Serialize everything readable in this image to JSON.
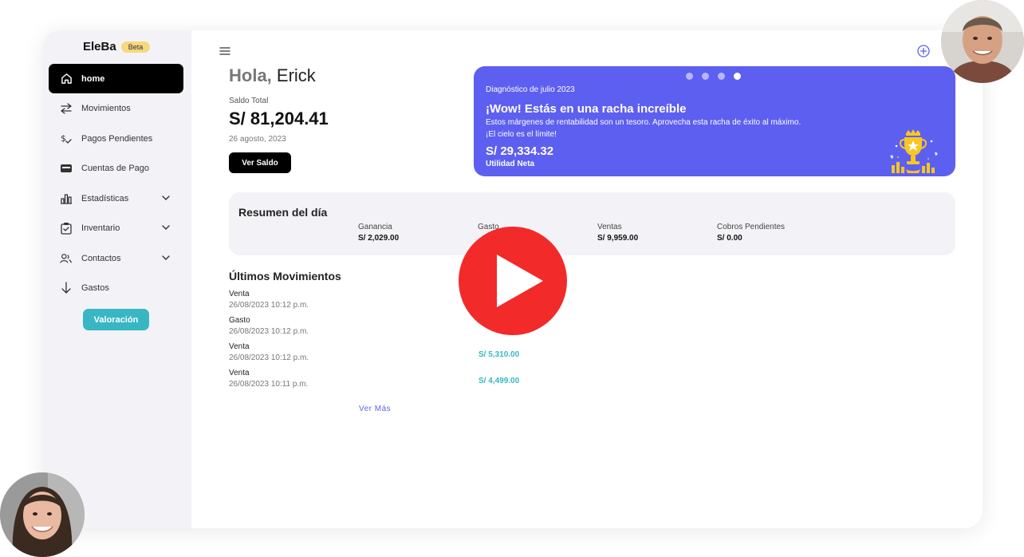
{
  "brand": {
    "name": "EleBa",
    "badge": "Beta"
  },
  "sidebar": {
    "items": [
      {
        "label": "home",
        "icon": "home-icon",
        "active": true
      },
      {
        "label": "Movimientos",
        "icon": "arrows-swap-icon"
      },
      {
        "label": "Pagos Pendientes",
        "icon": "dollar-check-icon"
      },
      {
        "label": "Cuentas de Pago",
        "icon": "wallet-icon"
      },
      {
        "label": "Estadísticas",
        "icon": "bar-chart-icon",
        "expandable": true
      },
      {
        "label": "Inventario",
        "icon": "clipboard-check-icon",
        "expandable": true
      },
      {
        "label": "Contactos",
        "icon": "users-icon",
        "expandable": true
      },
      {
        "label": "Gastos",
        "icon": "arrow-down-icon"
      }
    ],
    "valoracion_label": "Valoración"
  },
  "header": {
    "greeting": "Hola,",
    "user_name": "Erick"
  },
  "balance": {
    "label": "Saldo Total",
    "value": "S/ 81,204.41",
    "date": "26 agosto, 2023",
    "button_label": "Ver Saldo"
  },
  "banner": {
    "subtitle": "Diagnóstico de julio 2023",
    "title": "¡Wow! Estás en una racha increíble",
    "message": "Estos márgenes de rentabilidad son un tesoro. Aprovecha esta racha de éxito al máximo. ¡El cielo es el límite!",
    "amount": "S/ 29,334.32",
    "amount_caption": "Utilidad Neta",
    "slide_count": 4,
    "active_slide": 4,
    "color": "#5d5ff0"
  },
  "summary": {
    "title": "Resumen del día",
    "metrics": [
      {
        "label": "Ganancia",
        "value": "S/ 2,029.00"
      },
      {
        "label": "Gasto",
        "value": ""
      },
      {
        "label": "Ventas",
        "value": "S/ 9,959.00"
      },
      {
        "label": "Cobros Pendientes",
        "value": "S/ 0.00"
      }
    ]
  },
  "movements": {
    "title": "Últimos Movimientos",
    "items": [
      {
        "type": "Venta",
        "date": "26/08/2023 10:12 p.m.",
        "amount": ""
      },
      {
        "type": "Gasto",
        "date": "26/08/2023 10:12 p.m.",
        "amount": ""
      },
      {
        "type": "Venta",
        "date": "26/08/2023 10:12 p.m.",
        "amount": "S/ 5,310.00"
      },
      {
        "type": "Venta",
        "date": "26/08/2023 10:11 p.m.",
        "amount": "S/ 4,499.00"
      }
    ],
    "more_label": "Ver Más"
  },
  "colors": {
    "accent": "#5d5ff0",
    "teal": "#38b6c3",
    "play": "#f22a2a",
    "sidebar_bg": "#f3f3f7"
  }
}
